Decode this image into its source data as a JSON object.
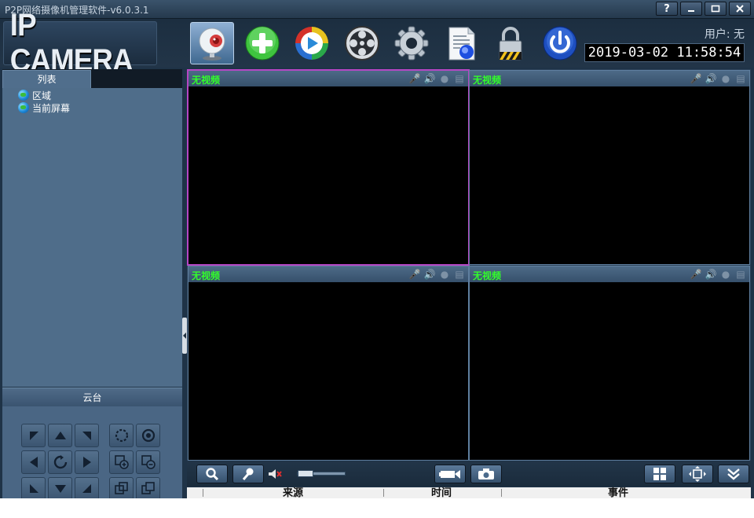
{
  "window": {
    "title": "P2P网络摄像机管理软件-v6.0.3.1",
    "buttons": {
      "help": "?",
      "minimize": "–",
      "maximize": "□",
      "close": "×"
    }
  },
  "header": {
    "logo": "IP CAMERA",
    "user_label": "用户: 无",
    "datetime": "2019-03-02 11:58:54",
    "toolbar": [
      {
        "icon": "camera-monitor-icon",
        "active": true
      },
      {
        "icon": "add-icon"
      },
      {
        "icon": "playback-icon"
      },
      {
        "icon": "film-reel-icon"
      },
      {
        "icon": "gear-icon"
      },
      {
        "icon": "log-document-icon"
      },
      {
        "icon": "lock-icon"
      },
      {
        "icon": "power-icon"
      }
    ]
  },
  "sidebar": {
    "tab_label": "列表",
    "tree": [
      {
        "label": "区域",
        "icon": "globe-icon"
      },
      {
        "label": "当前屏幕",
        "icon": "globe-icon"
      }
    ],
    "ptz_label": "云台"
  },
  "video": {
    "panes": [
      {
        "title": "无视频",
        "selected": true
      },
      {
        "title": "无视频",
        "selected": false
      },
      {
        "title": "无视频",
        "selected": false
      },
      {
        "title": "无视频",
        "selected": false
      }
    ]
  },
  "event_log": {
    "columns": [
      "来源",
      "时间",
      "事件"
    ]
  },
  "colors": {
    "no_video_text": "#32ff2a",
    "selected_border": "#b646c4",
    "panel_bg": "#4f6d8a",
    "app_bg": "#1f3347"
  }
}
